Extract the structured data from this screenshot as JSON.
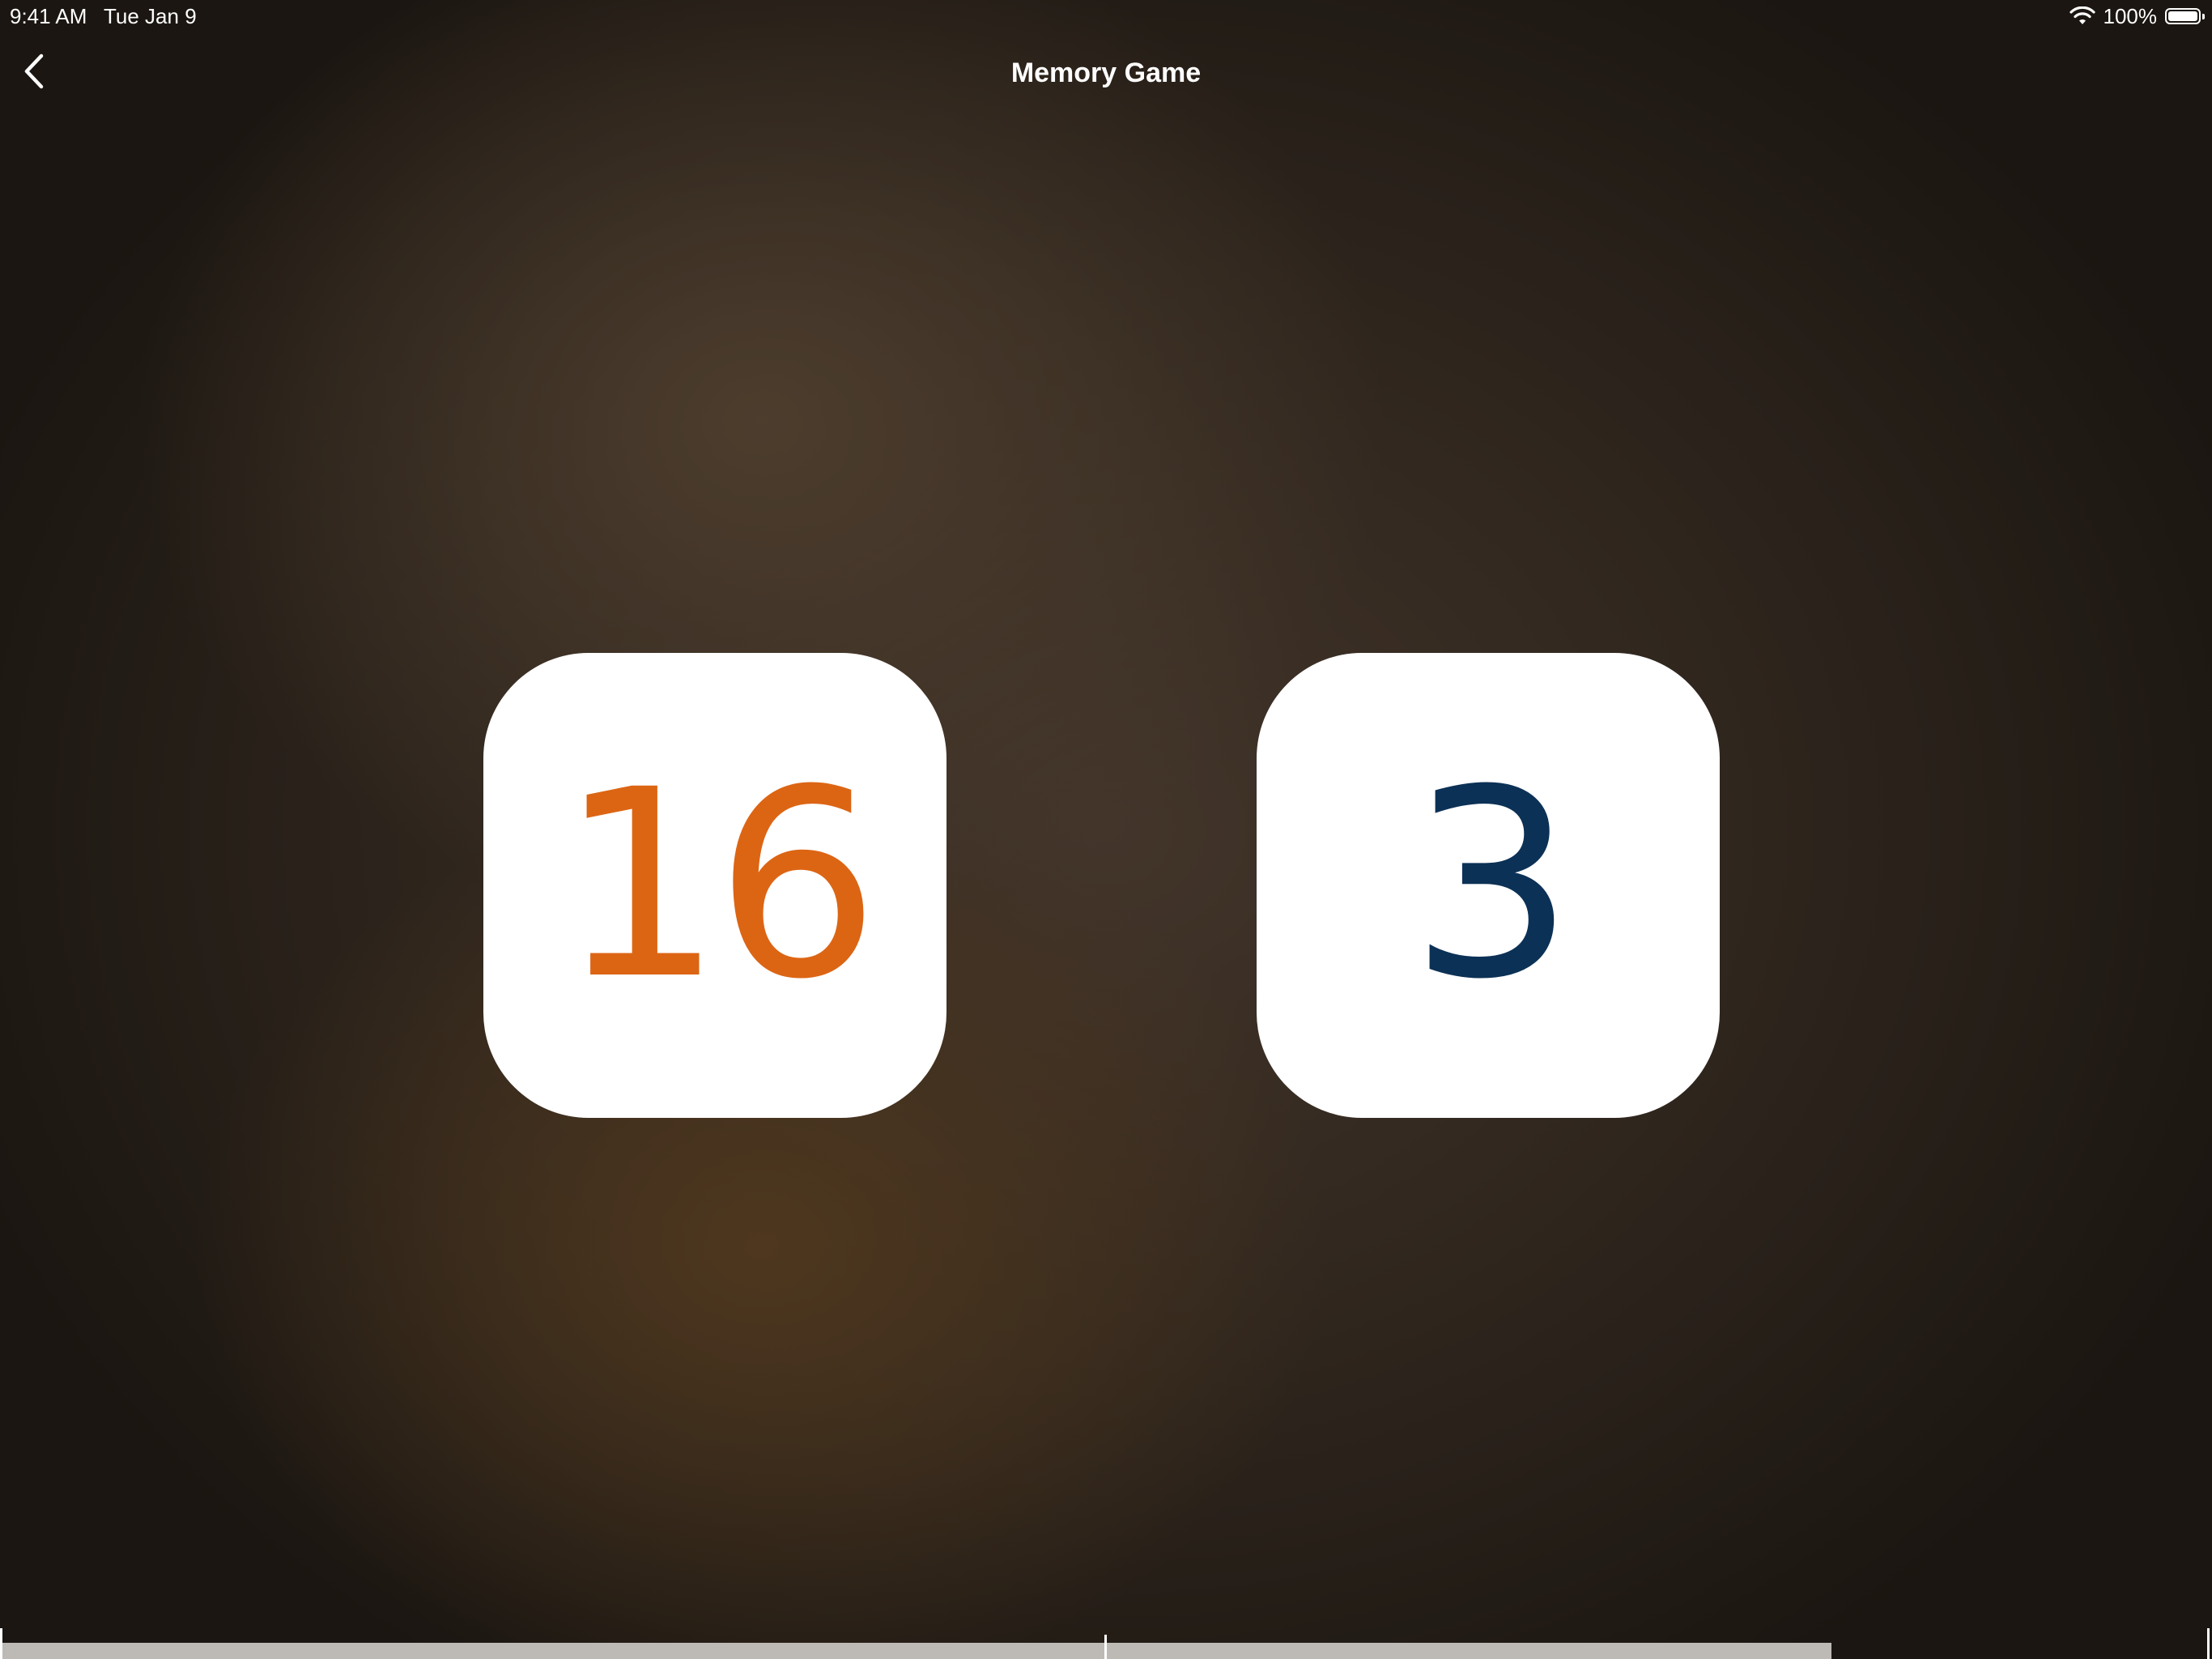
{
  "status_bar": {
    "time": "9:41 AM",
    "date": "Tue Jan 9",
    "battery_percent": "100%",
    "wifi_icon": "wifi-icon",
    "battery_icon": "battery-full-icon"
  },
  "nav": {
    "title": "Memory Game",
    "back_icon": "chevron-left-icon"
  },
  "cards": [
    {
      "value": "16",
      "color": "#dc6514"
    },
    {
      "value": "3",
      "color": "#0c3156"
    }
  ],
  "colors": {
    "card_background": "#ffffff",
    "track": "#bdbab6"
  }
}
